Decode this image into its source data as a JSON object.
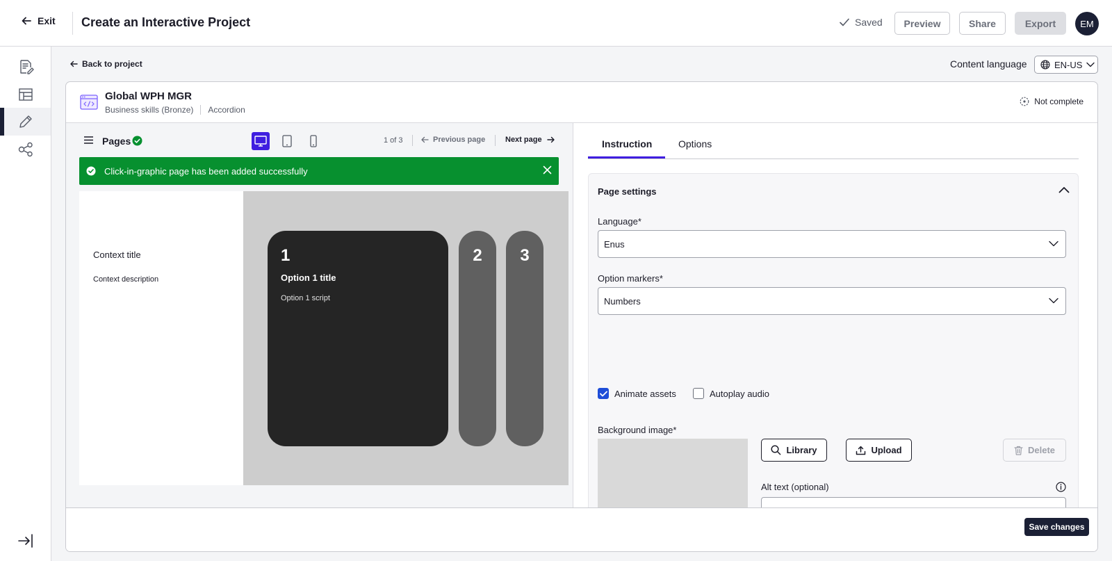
{
  "header": {
    "exit_label": "Exit",
    "title": "Create an Interactive Project",
    "saved_label": "Saved",
    "preview_label": "Preview",
    "share_label": "Share",
    "export_label": "Export",
    "avatar_initials": "EM"
  },
  "rail": {
    "items": [
      {
        "icon": "edit-document-icon"
      },
      {
        "icon": "layout-icon"
      },
      {
        "icon": "pencil-icon",
        "active": true
      },
      {
        "icon": "share-nodes-icon"
      }
    ],
    "collapse_icon": "collapse-right-icon"
  },
  "topline": {
    "back_label": "Back to project",
    "content_language_label": "Content language",
    "language_value": "EN-US"
  },
  "project": {
    "name": "Global WPH MGR",
    "category": "Business skills (Bronze)",
    "type": "Accordion",
    "status": "Not complete"
  },
  "preview": {
    "pages_label": "Pages",
    "page_count": "1 of 3",
    "previous_label": "Previous page",
    "next_label": "Next page",
    "toast_message": "Click-in-graphic page has been added successfully",
    "context_title": "Context title",
    "context_description": "Context description",
    "options": [
      {
        "number": "1",
        "title": "Option 1 title",
        "script": "Option 1 script"
      },
      {
        "number": "2"
      },
      {
        "number": "3"
      }
    ],
    "colors": {
      "accent": "#3f1ee0",
      "success": "#07902f",
      "card_dark": "#252525",
      "card_gray": "#606060"
    }
  },
  "settings": {
    "tabs": [
      "Instruction",
      "Options"
    ],
    "section_title": "Page settings",
    "language_label": "Language*",
    "language_value": "Enus",
    "markers_label": "Option markers*",
    "markers_value": "Numbers",
    "animate_label": "Animate assets",
    "animate_checked": true,
    "autoplay_label": "Autoplay audio",
    "autoplay_checked": false,
    "bg_label": "Background image*",
    "library_label": "Library",
    "upload_label": "Upload",
    "delete_label": "Delete",
    "alt_label": "Alt text (optional)",
    "alt_value": ""
  },
  "footer": {
    "save_label": "Save changes"
  }
}
